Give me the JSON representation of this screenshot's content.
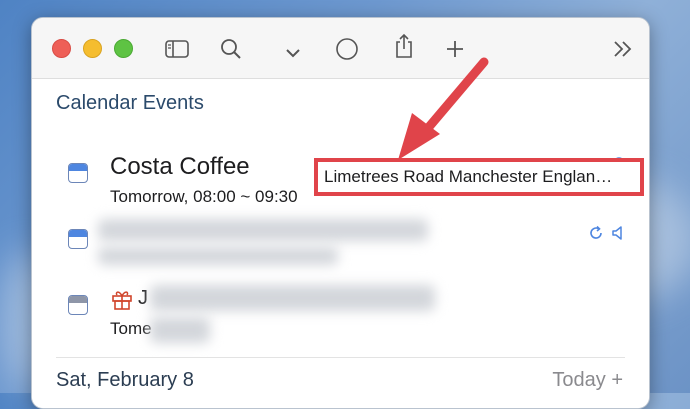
{
  "section": {
    "title": "Calendar Events"
  },
  "events": [
    {
      "title": "Costa Coffee",
      "time": "Tomorrow, 08:00 ~ 09:30",
      "location": "Limetrees Road Manchester Englan…"
    },
    {
      "title": "",
      "time": ""
    },
    {
      "title": "J",
      "time": "Tome"
    }
  ],
  "date_group": {
    "label": "Sat, February 8",
    "today_label": "Today +"
  },
  "icons": [
    "sidebar-toggle-icon",
    "search-icon",
    "chevron-down-icon",
    "circle-icon",
    "share-icon",
    "plus-icon",
    "double-chevron-right-icon",
    "repeat-icon",
    "alert-icon",
    "location-icon",
    "gift-icon",
    "calendar-icon"
  ],
  "colors": {
    "accent": "#4e86e0",
    "callout": "#e0444a",
    "close": "#ee5f57",
    "minimize": "#f5bd2f",
    "zoom": "#5ec343"
  }
}
